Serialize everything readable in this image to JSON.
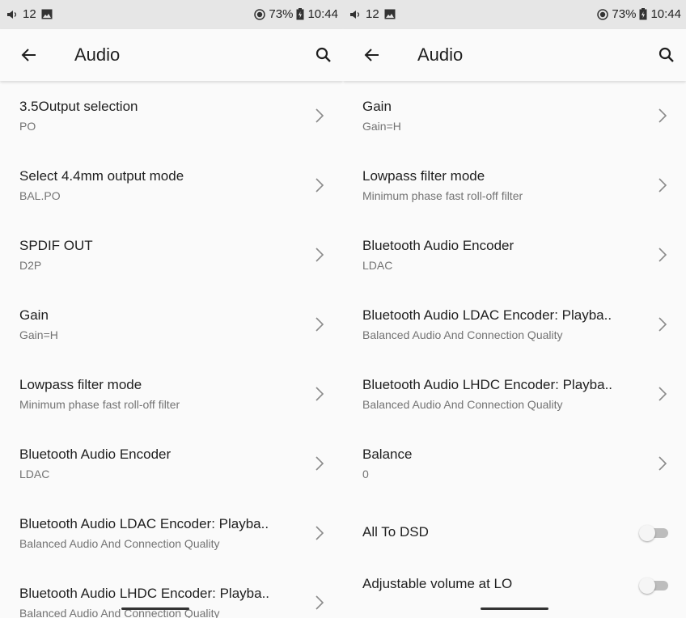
{
  "status": {
    "time": "10:44",
    "battery": "73%",
    "volume": "12"
  },
  "left": {
    "title": "Audio",
    "items": [
      {
        "title": "3.5Output selection",
        "subtitle": "PO"
      },
      {
        "title": "Select 4.4mm output mode",
        "subtitle": "BAL.PO"
      },
      {
        "title": "SPDIF OUT",
        "subtitle": "D2P"
      },
      {
        "title": "Gain",
        "subtitle": "Gain=H"
      },
      {
        "title": "Lowpass filter mode",
        "subtitle": "Minimum phase fast roll-off filter"
      },
      {
        "title": "Bluetooth Audio Encoder",
        "subtitle": "LDAC"
      },
      {
        "title": "Bluetooth Audio LDAC Encoder: Playba..",
        "subtitle": "Balanced Audio And Connection Quality"
      },
      {
        "title": "Bluetooth Audio LHDC Encoder: Playba..",
        "subtitle": "Balanced Audio And Connection Quality"
      }
    ]
  },
  "right": {
    "title": "Audio",
    "items": [
      {
        "title": "Gain",
        "subtitle": "Gain=H"
      },
      {
        "title": "Lowpass filter mode",
        "subtitle": "Minimum phase fast roll-off filter"
      },
      {
        "title": "Bluetooth Audio Encoder",
        "subtitle": "LDAC"
      },
      {
        "title": "Bluetooth Audio LDAC Encoder: Playba..",
        "subtitle": "Balanced Audio And Connection Quality"
      },
      {
        "title": "Bluetooth Audio LHDC Encoder: Playba..",
        "subtitle": "Balanced Audio And Connection Quality"
      },
      {
        "title": "Balance",
        "subtitle": "0"
      }
    ],
    "switches": [
      {
        "title": "All To DSD",
        "checked": false
      },
      {
        "title": "Adjustable volume at LO",
        "checked": false
      }
    ]
  },
  "colors": {
    "background": "#fafafa",
    "status_bar": "#e6e6e6",
    "primary_text": "#1f1f1f",
    "secondary_text": "#737373",
    "switch_off": "#bdbdbd"
  }
}
